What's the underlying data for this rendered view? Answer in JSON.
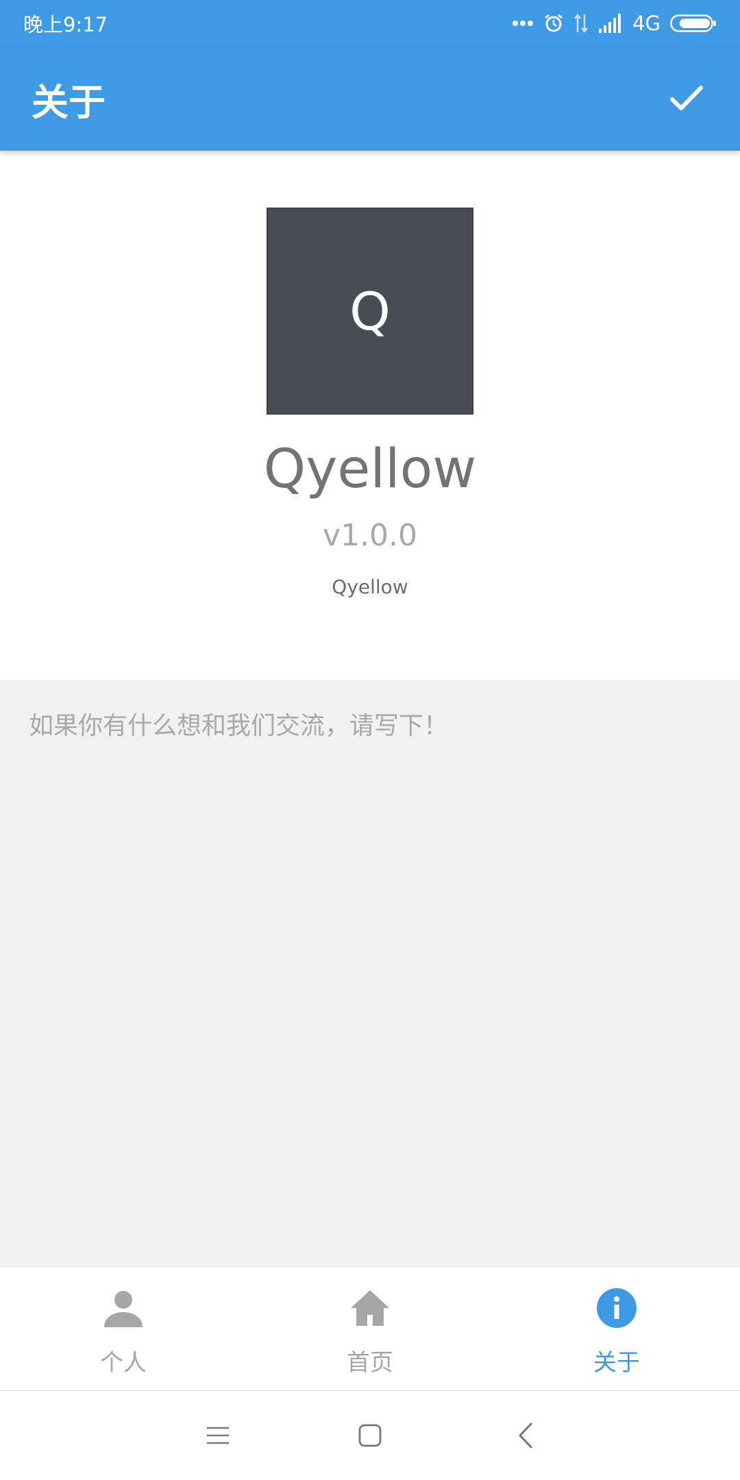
{
  "status_bar": {
    "time": "晚上9:17",
    "network": "4G",
    "icons": [
      "more-dots-icon",
      "alarm-icon",
      "data-transfer-icon",
      "signal-icon",
      "battery-icon"
    ]
  },
  "app_bar": {
    "title": "关于",
    "confirm_icon": "check-icon"
  },
  "about": {
    "logo_letter": "Q",
    "app_name": "Qyellow",
    "version": "v1.0.0",
    "author": "Qyellow"
  },
  "feedback": {
    "value": "",
    "placeholder": "如果你有什么想和我们交流，请写下！"
  },
  "bottom_nav": {
    "items": [
      {
        "label": "个人",
        "icon": "person-icon",
        "active": false
      },
      {
        "label": "首页",
        "icon": "home-icon",
        "active": false
      },
      {
        "label": "关于",
        "icon": "info-icon",
        "active": true
      }
    ]
  },
  "colors": {
    "primary": "#3f9ae5",
    "logo_bg": "#474c55",
    "feedback_bg": "#f1f1f1",
    "inactive": "#a6a6a6"
  }
}
